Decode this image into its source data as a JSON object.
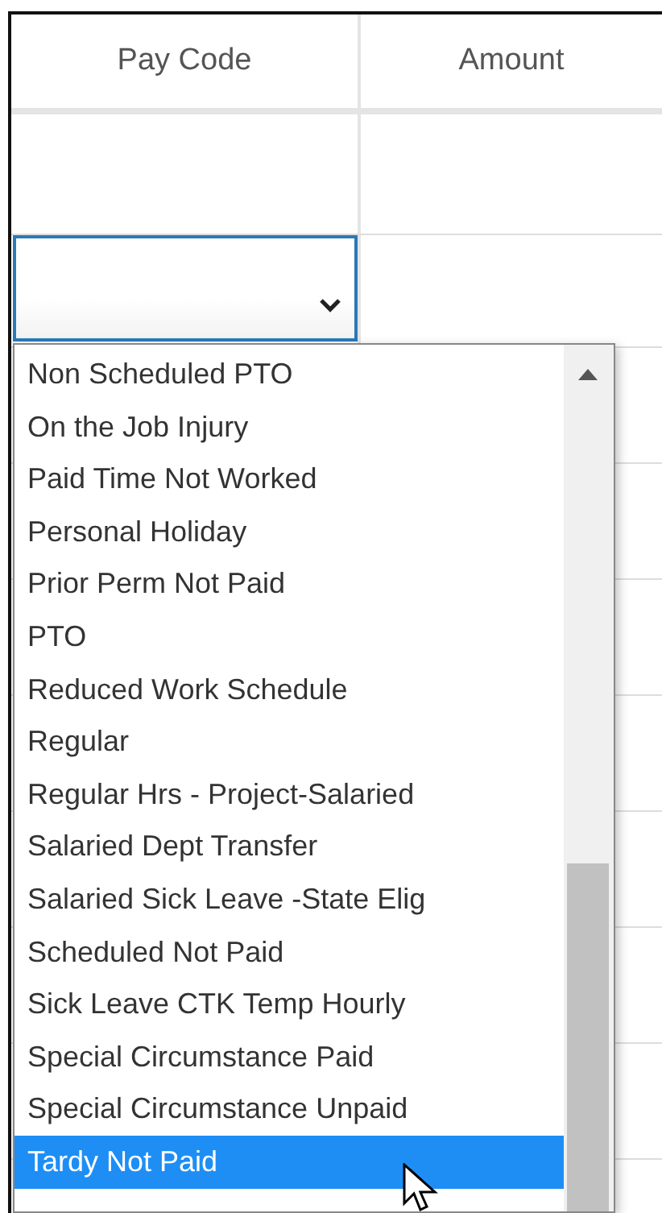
{
  "table": {
    "columns": [
      "Pay Code",
      "Amount"
    ]
  },
  "pay_code_select": {
    "expanded": true,
    "options": [
      {
        "label": "Non Scheduled PTO",
        "selected": false
      },
      {
        "label": "On the Job Injury",
        "selected": false
      },
      {
        "label": "Paid Time Not Worked",
        "selected": false
      },
      {
        "label": "Personal Holiday",
        "selected": false
      },
      {
        "label": "Prior Perm Not Paid",
        "selected": false
      },
      {
        "label": "PTO",
        "selected": false
      },
      {
        "label": "Reduced Work Schedule",
        "selected": false
      },
      {
        "label": "Regular",
        "selected": false
      },
      {
        "label": "Regular Hrs - Project-Salaried",
        "selected": false
      },
      {
        "label": "Salaried Dept Transfer",
        "selected": false
      },
      {
        "label": "Salaried Sick Leave -State Elig",
        "selected": false
      },
      {
        "label": "Scheduled Not Paid",
        "selected": false
      },
      {
        "label": "Sick Leave CTK Temp Hourly",
        "selected": false
      },
      {
        "label": "Special Circumstance Paid",
        "selected": false
      },
      {
        "label": "Special Circumstance Unpaid",
        "selected": false
      },
      {
        "label": "Tardy Not Paid",
        "selected": true
      }
    ]
  }
}
